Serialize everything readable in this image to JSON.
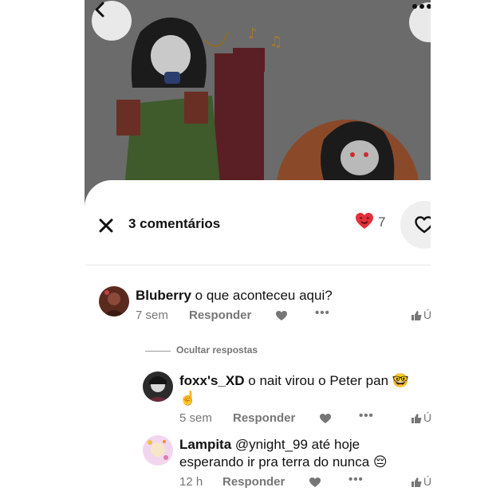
{
  "header": {
    "comments_label": "3 comentários",
    "reaction_count": "7"
  },
  "comments": [
    {
      "author": "Bluberry",
      "text": "o que aconteceu aqui?",
      "age": "7 sem",
      "reply_label": "Responder",
      "cut_text": "Ú"
    }
  ],
  "replies_toggle": "Ocultar respostas",
  "replies": [
    {
      "author": "foxx's_XD",
      "text_line1": "o nait virou o Peter pan 🤓",
      "text_line2": "☝️",
      "age": "5 sem",
      "reply_label": "Responder",
      "cut_text": "Ú"
    },
    {
      "author": "Lampita",
      "text_line1": "@ynight_99 até hoje",
      "text_line2": "esperando ir pra terra do nunca 😔",
      "age": "12 h",
      "reply_label": "Responder",
      "cut_text": "Ú"
    }
  ],
  "colors": {
    "accent_red": "#e0303a",
    "muted_text": "#767676"
  },
  "icons": {
    "back": "chevron-left-icon",
    "more": "more-icon",
    "close": "close-icon",
    "reaction": "heart-eyes-icon",
    "like": "heart-outline-icon",
    "thumb": "thumbs-up-icon"
  }
}
